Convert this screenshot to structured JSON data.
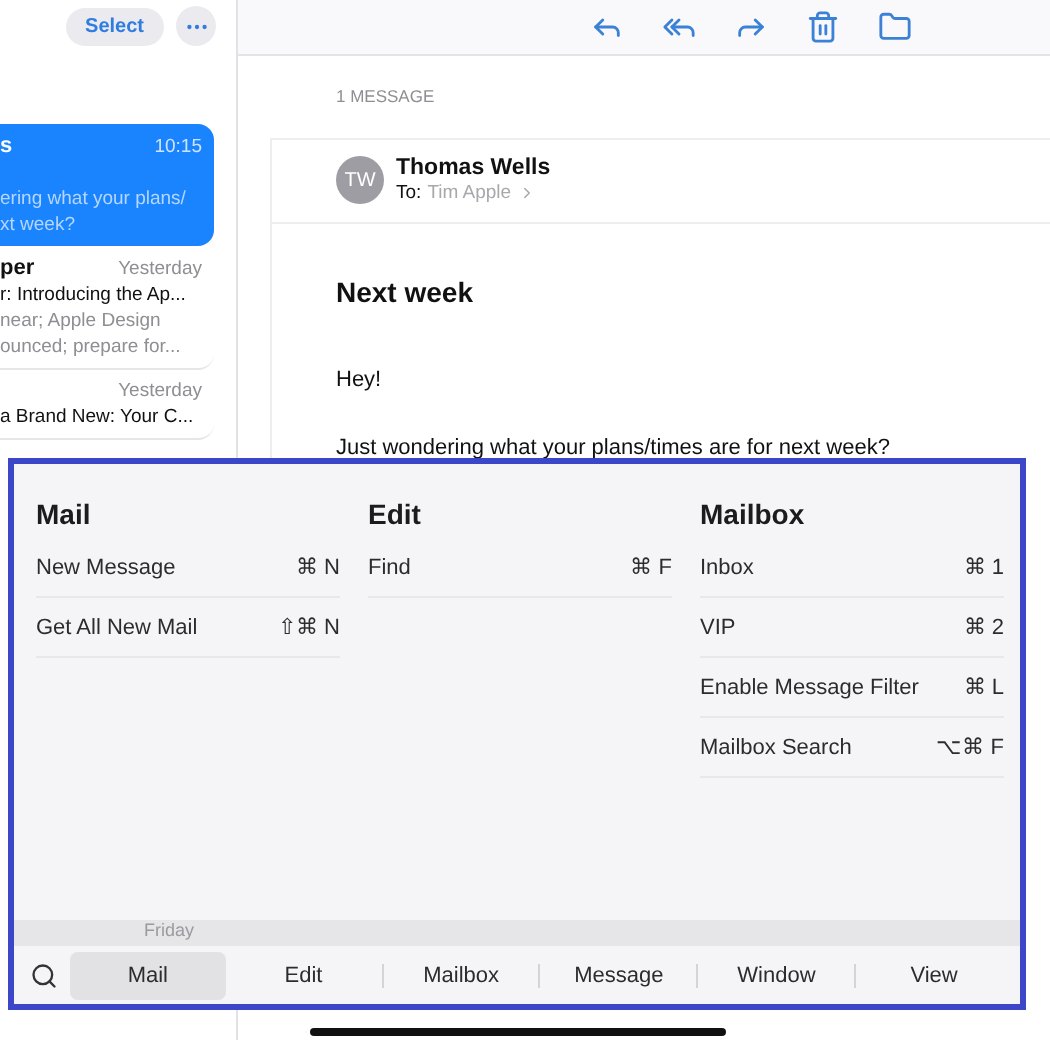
{
  "sidebar": {
    "select_button": "Select",
    "messages": [
      {
        "sender": "s",
        "time": "10:15",
        "preview": [
          "ering what your plans/",
          "xt week?"
        ],
        "selected": true
      },
      {
        "sender": "per",
        "time": "Yesterday",
        "subject": "r: Introducing the Ap...",
        "preview": [
          "near; Apple Design",
          "ounced; prepare for..."
        ],
        "selected": false
      },
      {
        "time": "Yesterday",
        "subject": "a Brand New: Your C...",
        "selected": false
      }
    ]
  },
  "message_view": {
    "count_label": "1 MESSAGE",
    "sender": {
      "initials": "TW",
      "name": "Thomas Wells",
      "to_label": "To:",
      "to": "Tim Apple"
    },
    "subject": "Next week",
    "body": [
      "Hey!",
      "Just wondering what your plans/times are for next week?"
    ]
  },
  "menu_overlay": {
    "menus": [
      {
        "title": "Mail",
        "items": [
          {
            "label": "New Message",
            "shortcut": "⌘ N"
          },
          {
            "label": "Get All New Mail",
            "shortcut": "⇧⌘ N"
          }
        ]
      },
      {
        "title": "Edit",
        "items": [
          {
            "label": "Find",
            "shortcut": "⌘ F"
          }
        ]
      },
      {
        "title": "Mailbox",
        "items": [
          {
            "label": "Inbox",
            "shortcut": "⌘ 1"
          },
          {
            "label": "VIP",
            "shortcut": "⌘ 2"
          },
          {
            "label": "Enable Message Filter",
            "shortcut": "⌘ L"
          },
          {
            "label": "Mailbox Search",
            "shortcut": "⌥⌘ F"
          }
        ]
      }
    ],
    "list_time_behind": "Friday",
    "menu_bar": [
      {
        "label": "Mail",
        "selected": true
      },
      {
        "label": "Edit",
        "selected": false
      },
      {
        "label": "Mailbox",
        "selected": false
      },
      {
        "label": "Message",
        "selected": false
      },
      {
        "label": "Window",
        "selected": false
      },
      {
        "label": "View",
        "selected": false
      }
    ]
  }
}
